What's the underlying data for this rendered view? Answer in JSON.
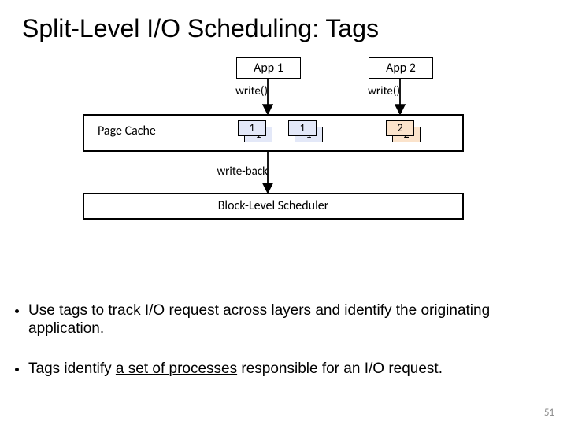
{
  "title": "Split-Level I/O Scheduling: Tags",
  "apps": {
    "app1": "App 1",
    "app2": "App 2"
  },
  "calls": {
    "write1": "write()",
    "write2": "write()",
    "writeback": "write-back"
  },
  "page_cache_label": "Page Cache",
  "tags": {
    "a_front": "1",
    "a_back": "1",
    "b_front": "1",
    "b_back": "1",
    "c_front": "2",
    "c_back": "2"
  },
  "sched_label": "Block-Level Scheduler",
  "bullets": {
    "b1_pre": "Use ",
    "b1_u": "tags",
    "b1_post": " to track I/O request across layers and identify the originating application.",
    "b2_pre": "Tags identify ",
    "b2_u": "a set of processes",
    "b2_post": " responsible for an I/O request."
  },
  "slide_number": "51"
}
